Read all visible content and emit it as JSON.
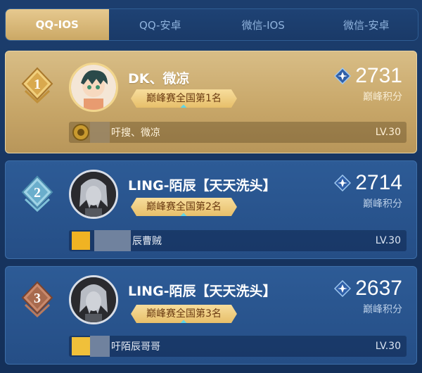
{
  "tabs": [
    {
      "label": "QQ-IOS",
      "active": true
    },
    {
      "label": "QQ-安卓",
      "active": false
    },
    {
      "label": "微信-IOS",
      "active": false
    },
    {
      "label": "微信-安卓",
      "active": false
    }
  ],
  "entries": [
    {
      "rank": "1",
      "name": "DK、微凉",
      "title": "巅峰赛全国第1名",
      "score": "2731",
      "score_label": "巅峰积分",
      "game_name": "吁搜、微凉",
      "level": "LV.30",
      "theme": "gold"
    },
    {
      "rank": "2",
      "name": "LING-陌辰【天天洗头】",
      "title": "巅峰赛全国第2名",
      "score": "2714",
      "score_label": "巅峰积分",
      "game_name": "辰曹贼",
      "level": "LV.30",
      "theme": "blue"
    },
    {
      "rank": "3",
      "name": "LING-陌辰【天天洗头】",
      "title": "巅峰赛全国第3名",
      "score": "2637",
      "score_label": "巅峰积分",
      "game_name": "吁陌辰哥哥",
      "level": "LV.30",
      "theme": "blue"
    }
  ],
  "icons": {
    "rank_badge": "rank-badge-icon",
    "peak_score": "peak-score-icon",
    "game_logo": "game-logo-icon"
  },
  "colors": {
    "gold_card": "#c8a769",
    "blue_card": "#2d5b96",
    "tab_active": "#d9bb7a",
    "background": "#1a3a68",
    "rank1_badge": "#e2b45a",
    "rank2_badge": "#7fc0d8",
    "rank3_badge": "#a86a4e"
  }
}
